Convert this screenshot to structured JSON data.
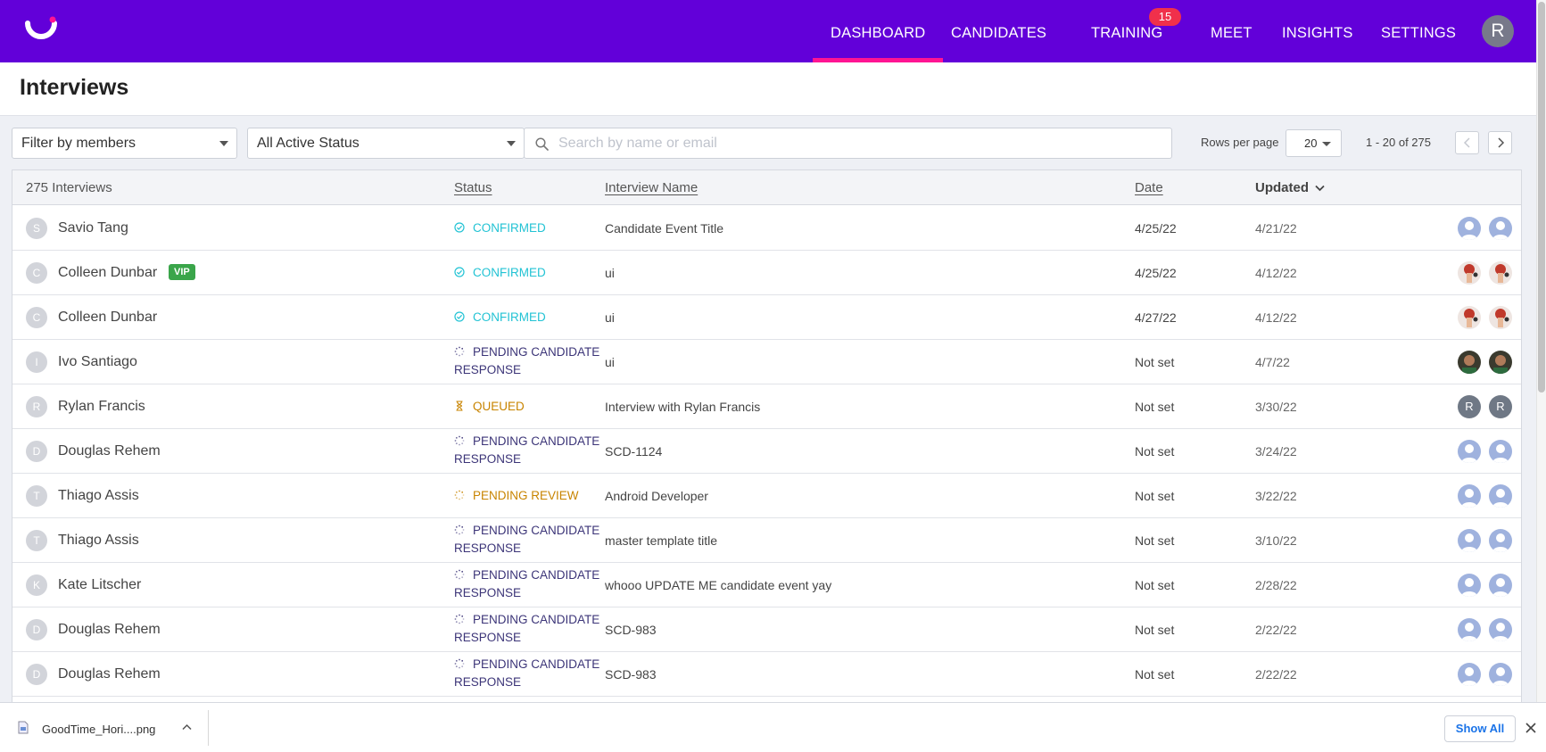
{
  "nav": {
    "items": [
      {
        "label": "DASHBOARD",
        "active": true
      },
      {
        "label": "CANDIDATES",
        "active": false
      },
      {
        "label": "TRAINING",
        "active": false,
        "badge": "15"
      },
      {
        "label": "MEET",
        "active": false
      },
      {
        "label": "INSIGHTS",
        "active": false
      },
      {
        "label": "SETTINGS",
        "active": false
      }
    ],
    "user_initial": "R",
    "brand_color": "#6200d9",
    "active_color": "#ff1493"
  },
  "page": {
    "title": "Interviews"
  },
  "filters": {
    "members": "Filter by members",
    "status": "All Active Status",
    "search_placeholder": "Search by name or email",
    "rows_per_page_label": "Rows per page",
    "rows_per_page": "20",
    "range": "1 - 20 of 275"
  },
  "table": {
    "headers": {
      "count": "275 Interviews",
      "status": "Status",
      "interview_name": "Interview Name",
      "date": "Date",
      "updated": "Updated"
    },
    "rows": [
      {
        "initial": "S",
        "name": "Savio Tang",
        "vip": "",
        "status": "CONFIRMED",
        "status_type": "confirmed",
        "interview": "Candidate Event Title",
        "date": "4/25/22",
        "updated": "4/21/22",
        "avatars": "default"
      },
      {
        "initial": "C",
        "name": "Colleen Dunbar",
        "vip": "VIP",
        "status": "CONFIRMED",
        "status_type": "confirmed",
        "interview": "ui",
        "date": "4/25/22",
        "updated": "4/12/22",
        "avatars": "photo1"
      },
      {
        "initial": "C",
        "name": "Colleen Dunbar",
        "vip": "",
        "status": "CONFIRMED",
        "status_type": "confirmed",
        "interview": "ui",
        "date": "4/27/22",
        "updated": "4/12/22",
        "avatars": "photo1"
      },
      {
        "initial": "I",
        "name": "Ivo Santiago",
        "vip": "",
        "status": "PENDING CANDIDATE RESPONSE",
        "status_type": "pending",
        "interview": "ui",
        "date": "Not set",
        "updated": "4/7/22",
        "avatars": "photo2"
      },
      {
        "initial": "R",
        "name": "Rylan Francis",
        "vip": "",
        "status": "QUEUED",
        "status_type": "queued",
        "interview": "Interview with Rylan Francis",
        "date": "Not set",
        "updated": "3/30/22",
        "avatars": "letter",
        "avatar_letter": "R"
      },
      {
        "initial": "D",
        "name": "Douglas Rehem",
        "vip": "",
        "status": "PENDING CANDIDATE RESPONSE",
        "status_type": "pending",
        "interview": "SCD-1124",
        "date": "Not set",
        "updated": "3/24/22",
        "avatars": "default"
      },
      {
        "initial": "T",
        "name": "Thiago Assis",
        "vip": "",
        "status": "PENDING REVIEW",
        "status_type": "review",
        "interview": "Android Developer",
        "date": "Not set",
        "updated": "3/22/22",
        "avatars": "default"
      },
      {
        "initial": "T",
        "name": "Thiago Assis",
        "vip": "",
        "status": "PENDING CANDIDATE RESPONSE",
        "status_type": "pending",
        "interview": "master template title",
        "date": "Not set",
        "updated": "3/10/22",
        "avatars": "default"
      },
      {
        "initial": "K",
        "name": "Kate Litscher",
        "vip": "",
        "status": "PENDING CANDIDATE RESPONSE",
        "status_type": "pending",
        "interview": "whooo UPDATE ME candidate event yay",
        "date": "Not set",
        "updated": "2/28/22",
        "avatars": "default"
      },
      {
        "initial": "D",
        "name": "Douglas Rehem",
        "vip": "",
        "status": "PENDING CANDIDATE RESPONSE",
        "status_type": "pending",
        "interview": "SCD-983",
        "date": "Not set",
        "updated": "2/22/22",
        "avatars": "default"
      },
      {
        "initial": "D",
        "name": "Douglas Rehem",
        "vip": "",
        "status": "PENDING CANDIDATE RESPONSE",
        "status_type": "pending",
        "interview": "SCD-983",
        "date": "Not set",
        "updated": "2/22/22",
        "avatars": "default"
      }
    ]
  },
  "downloads": {
    "file_name": "GoodTime_Hori....png",
    "show_all": "Show All"
  },
  "status_colors": {
    "confirmed": "#22c3d4",
    "pending": "#3c3578",
    "queued": "#c88400",
    "review": "#c88400"
  }
}
